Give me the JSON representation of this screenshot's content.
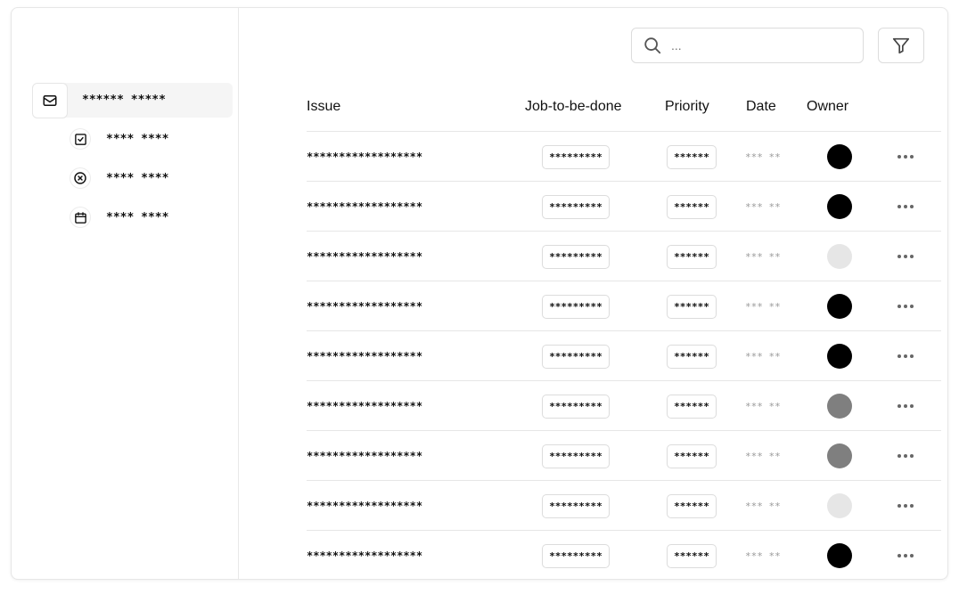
{
  "sidebar": {
    "items": [
      {
        "label": "****** *****",
        "icon": "mail-icon",
        "active": true
      },
      {
        "label": "**** ****",
        "icon": "check-square-icon",
        "active": false
      },
      {
        "label": "**** ****",
        "icon": "x-circle-icon",
        "active": false
      },
      {
        "label": "**** ****",
        "icon": "calendar-icon",
        "active": false
      }
    ]
  },
  "toolbar": {
    "search_placeholder": "...",
    "search_icon": "search-icon",
    "filter_icon": "filter-icon"
  },
  "table": {
    "headers": {
      "issue": "Issue",
      "job": "Job-to-be-done",
      "priority": "Priority",
      "date": "Date",
      "owner": "Owner"
    },
    "rows": [
      {
        "issue": "******************",
        "job": "*********",
        "priority": "******",
        "date": "*** **",
        "owner_color": "#000000"
      },
      {
        "issue": "******************",
        "job": "*********",
        "priority": "******",
        "date": "*** **",
        "owner_color": "#000000"
      },
      {
        "issue": "******************",
        "job": "*********",
        "priority": "******",
        "date": "*** **",
        "owner_color": "#e6e6e6"
      },
      {
        "issue": "******************",
        "job": "*********",
        "priority": "******",
        "date": "*** **",
        "owner_color": "#000000"
      },
      {
        "issue": "******************",
        "job": "*********",
        "priority": "******",
        "date": "*** **",
        "owner_color": "#000000"
      },
      {
        "issue": "******************",
        "job": "*********",
        "priority": "******",
        "date": "*** **",
        "owner_color": "#7f7f7f"
      },
      {
        "issue": "******************",
        "job": "*********",
        "priority": "******",
        "date": "*** **",
        "owner_color": "#7f7f7f"
      },
      {
        "issue": "******************",
        "job": "*********",
        "priority": "******",
        "date": "*** **",
        "owner_color": "#e6e6e6"
      },
      {
        "issue": "******************",
        "job": "*********",
        "priority": "******",
        "date": "*** **",
        "owner_color": "#000000"
      }
    ]
  }
}
